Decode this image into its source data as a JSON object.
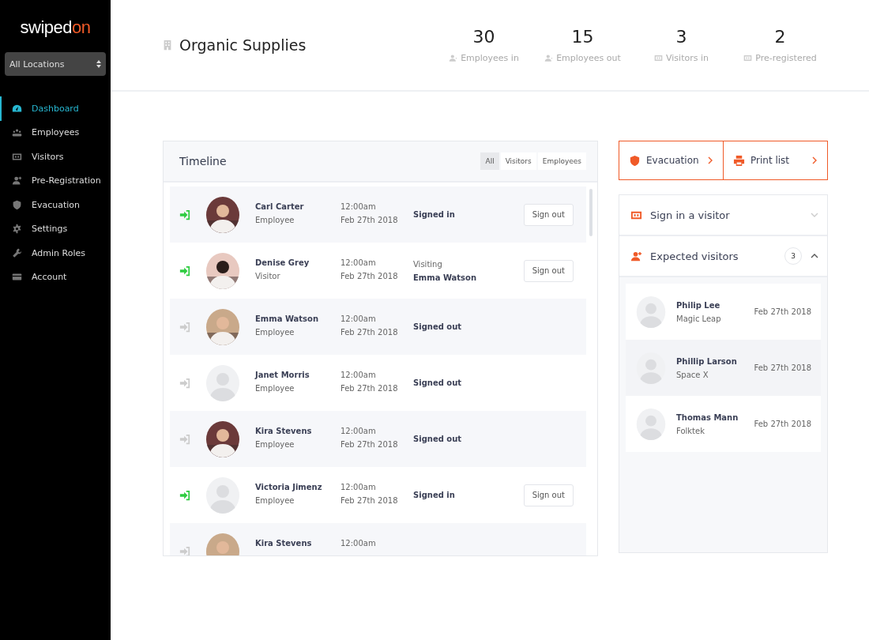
{
  "sidebar": {
    "logo": {
      "main": "swiped",
      "accent": "on"
    },
    "location": "All Locations",
    "items": [
      {
        "label": "Dashboard",
        "selected": true
      },
      {
        "label": "Employees",
        "selected": false
      },
      {
        "label": "Visitors",
        "selected": false
      },
      {
        "label": "Pre-Registration",
        "selected": false
      },
      {
        "label": "Evacuation",
        "selected": false
      },
      {
        "label": "Settings",
        "selected": false
      },
      {
        "label": "Admin Roles",
        "selected": false
      },
      {
        "label": "Account",
        "selected": false
      }
    ]
  },
  "header": {
    "title": "Organic Supplies",
    "stats": [
      {
        "value": "30",
        "label": "Employees in"
      },
      {
        "value": "15",
        "label": "Employees out"
      },
      {
        "value": "3",
        "label": "Visitors in"
      },
      {
        "value": "2",
        "label": "Pre-registered"
      }
    ]
  },
  "timeline": {
    "title": "Timeline",
    "filters": [
      {
        "label": "All",
        "selected": true
      },
      {
        "label": "Visitors",
        "selected": false
      },
      {
        "label": "Employees",
        "selected": false
      }
    ],
    "rows": [
      {
        "name": "Carl Carter",
        "role": "Employee",
        "time": "12:00am",
        "date": "Feb 27th 2018",
        "status": "Signed in",
        "signed_in": true,
        "has_photo": true,
        "action": "Sign out"
      },
      {
        "name": "Denise Grey",
        "role": "Visitor",
        "time": "12:00am",
        "date": "Feb 27th 2018",
        "status_note": "Visiting",
        "status": "Emma Watson",
        "signed_in": true,
        "has_photo": true,
        "action": "Sign out"
      },
      {
        "name": "Emma Watson",
        "role": "Employee",
        "time": "12:00am",
        "date": "Feb 27th 2018",
        "status": "Signed out",
        "signed_in": false,
        "has_photo": true
      },
      {
        "name": "Janet Morris",
        "role": "Employee",
        "time": "12:00am",
        "date": "Feb 27th 2018",
        "status": "Signed out",
        "signed_in": false,
        "has_photo": false
      },
      {
        "name": "Kira Stevens",
        "role": "Employee",
        "time": "12:00am",
        "date": "Feb 27th 2018",
        "status": "Signed out",
        "signed_in": false,
        "has_photo": true
      },
      {
        "name": "Victoria  Jimenz",
        "role": "Employee",
        "time": "12:00am",
        "date": "Feb 27th 2018",
        "status": "Signed in",
        "signed_in": true,
        "has_photo": false,
        "action": "Sign out"
      },
      {
        "name": "Kira Stevens",
        "time": "12:00am",
        "signed_in": false,
        "has_photo": true
      }
    ]
  },
  "actions": [
    {
      "label": "Evacuation"
    },
    {
      "label": "Print list"
    }
  ],
  "panels": [
    {
      "label": "Sign in a visitor",
      "expanded": false
    },
    {
      "label": "Expected visitors",
      "expanded": true,
      "count": "3"
    }
  ],
  "expected": [
    {
      "name": "Philip Lee",
      "company": "Magic Leap",
      "date": "Feb 27th 2018"
    },
    {
      "name": "Phillip Larson",
      "company": "Space X",
      "date": "Feb 27th 2018"
    },
    {
      "name": "Thomas Mann",
      "company": "Folktek",
      "date": "Feb 27th 2018"
    }
  ]
}
